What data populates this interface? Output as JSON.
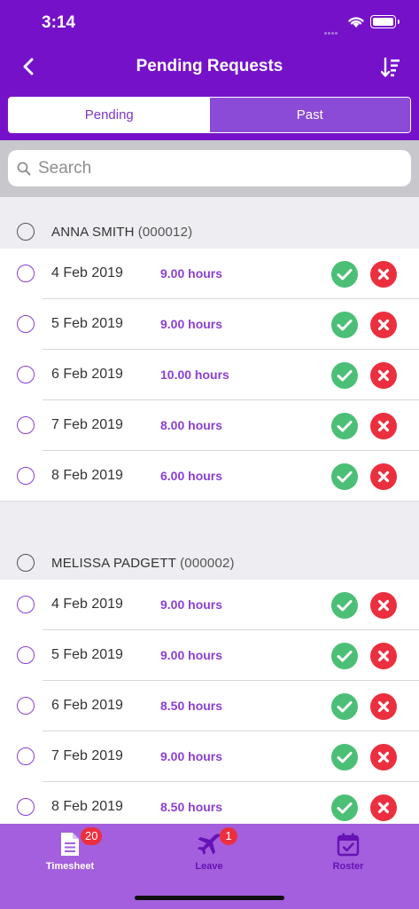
{
  "status_bar": {
    "time": "3:14"
  },
  "nav": {
    "title": "Pending Requests"
  },
  "segments": {
    "pending": "Pending",
    "past": "Past",
    "selected": "Pending"
  },
  "search": {
    "placeholder": "Search",
    "value": ""
  },
  "groups": [
    {
      "name": "ANNA SMITH",
      "code": "(000012)",
      "rows": [
        {
          "date": "4 Feb 2019",
          "hours": "9.00 hours"
        },
        {
          "date": "5 Feb 2019",
          "hours": "9.00 hours"
        },
        {
          "date": "6 Feb 2019",
          "hours": "10.00 hours"
        },
        {
          "date": "7 Feb 2019",
          "hours": "8.00 hours"
        },
        {
          "date": "8 Feb 2019",
          "hours": "6.00 hours"
        }
      ]
    },
    {
      "name": "MELISSA PADGETT",
      "code": "(000002)",
      "rows": [
        {
          "date": "4 Feb 2019",
          "hours": "9.00 hours"
        },
        {
          "date": "5 Feb 2019",
          "hours": "9.00 hours"
        },
        {
          "date": "6 Feb 2019",
          "hours": "8.50 hours"
        },
        {
          "date": "7 Feb 2019",
          "hours": "9.00 hours"
        },
        {
          "date": "8 Feb 2019",
          "hours": "8.50 hours"
        }
      ]
    }
  ],
  "tabs": {
    "timesheet": {
      "label": "Timesheet",
      "badge": "20",
      "icon": "document-icon"
    },
    "leave": {
      "label": "Leave",
      "badge": "1",
      "icon": "airplane-icon"
    },
    "roster": {
      "label": "Roster",
      "icon": "calendar-check-icon"
    }
  },
  "colors": {
    "header": "#7512c9",
    "accent": "#8c3fd3",
    "approve": "#4cbf76",
    "reject": "#ec2f3e",
    "tabbar": "#a35fdd"
  }
}
